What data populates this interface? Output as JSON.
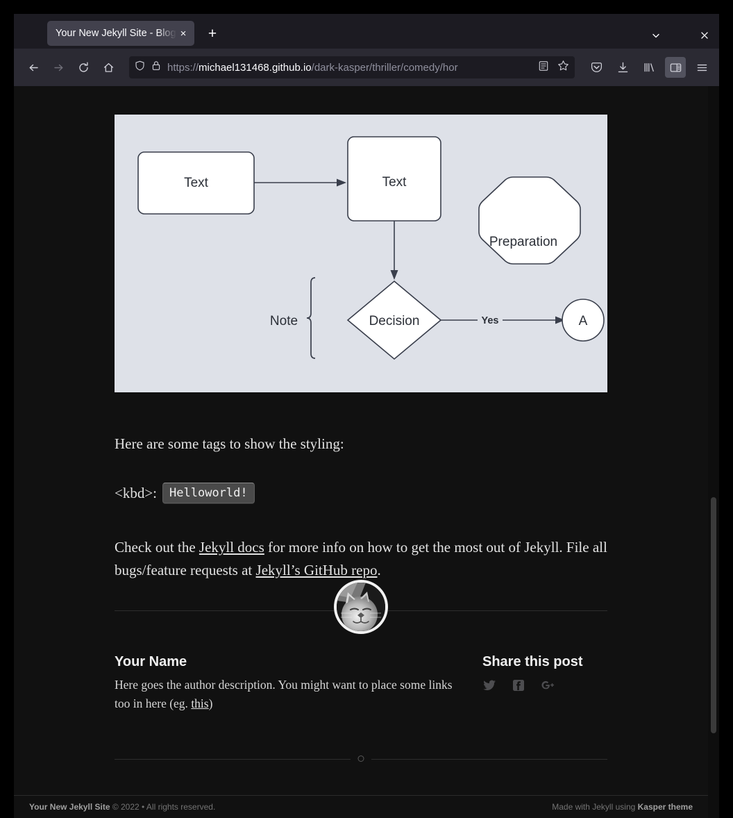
{
  "browser": {
    "tab": {
      "title": "Your New Jekyll Site - Bloggi",
      "close_label": "×"
    },
    "new_tab_label": "+",
    "list_all_tabs_icon": "chevron-down-icon",
    "window_close_label": "×",
    "nav": {
      "back_label": "←",
      "forward_label": "→",
      "reload_label": "↻",
      "home_label": "⌂"
    },
    "urlbar": {
      "shield_icon": "shield-icon",
      "lock_icon": "lock-icon",
      "url_scheme": "https://",
      "url_host": "michael131468.github.io",
      "url_path": "/dark-kasper/thriller/comedy/hor",
      "url_full": "https://michael131468.github.io/dark-kasper/thriller/comedy/hor",
      "reader_icon": "reader-view-icon",
      "bookmark_icon": "star-icon"
    },
    "toolbar": {
      "pocket_icon": "pocket-icon",
      "downloads_icon": "download-icon",
      "library_icon": "library-icon",
      "sidebar_icon": "sidebar-icon",
      "menu_icon": "hamburger-menu-icon"
    },
    "colors": {
      "tabstrip_bg": "#1c1b22",
      "navbar_bg": "#2b2a33",
      "urlbar_bg": "#1c1b22",
      "active_tool_bg": "#52525e",
      "page_bg": "#111111"
    }
  },
  "chart_data": {
    "type": "diagram",
    "subtype": "flowchart",
    "background": "#dee1e8",
    "node_fill": "#ffffff",
    "node_stroke": "#3a3f4c",
    "nodes": [
      {
        "id": "n1",
        "label": "Text",
        "shape": "rounded-rectangle"
      },
      {
        "id": "n2",
        "label": "Text",
        "shape": "rounded-rectangle"
      },
      {
        "id": "n3",
        "label": "Preparation",
        "shape": "hexagon"
      },
      {
        "id": "n4",
        "label": "Decision",
        "shape": "diamond"
      },
      {
        "id": "n5",
        "label": "A",
        "shape": "circle"
      },
      {
        "id": "n6",
        "label": "Note",
        "shape": "brace-note"
      }
    ],
    "edges": [
      {
        "from": "n1",
        "to": "n2",
        "label": "",
        "direction": "right"
      },
      {
        "from": "n2",
        "to": "n4",
        "label": "",
        "direction": "down"
      },
      {
        "from": "n4",
        "to": "n5",
        "label": "Yes",
        "direction": "right"
      }
    ]
  },
  "post": {
    "tags_intro": "Here are some tags to show the styling:",
    "kbd_label": "<kbd>:",
    "kbd_value": "Helloworld!",
    "check_out_prefix": "Check out the ",
    "jekyll_docs_link": "Jekyll docs",
    "check_out_middle": " for more info on how to get the most out of Jekyll. File all bugs/feature requests at ",
    "github_repo_link": "Jekyll’s GitHub repo",
    "check_out_suffix": "."
  },
  "author": {
    "avatar_icon": "cat-avatar",
    "name": "Your Name",
    "bio_prefix": "Here goes the author description. You might want to place some links too in here (eg. ",
    "bio_link": "this",
    "bio_suffix": ")"
  },
  "share": {
    "title": "Share this post",
    "items": [
      {
        "icon": "twitter-icon",
        "name": "Twitter"
      },
      {
        "icon": "facebook-icon",
        "name": "Facebook"
      },
      {
        "icon": "google-plus-icon",
        "name": "Google Plus"
      }
    ]
  },
  "footer": {
    "site_name": "Your New Jekyll Site",
    "copyright": " © 2022 • All rights reserved.",
    "made_with": "Made with Jekyll using ",
    "theme": "Kasper theme"
  }
}
